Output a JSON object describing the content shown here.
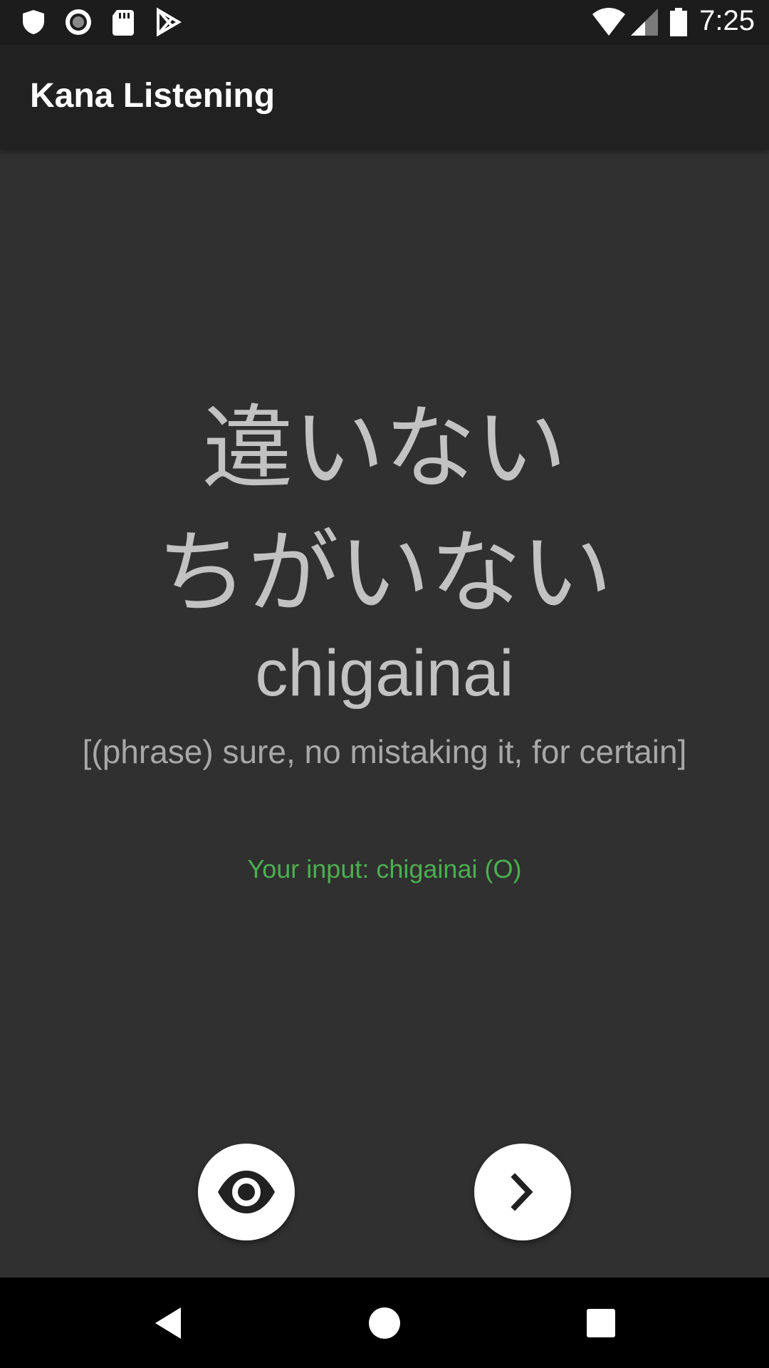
{
  "status_bar": {
    "time": "7:25",
    "icons_left": [
      "shield-icon",
      "record-icon",
      "sd-card-icon",
      "play-store-icon"
    ],
    "icons_right": [
      "wifi-icon",
      "cellular-signal-icon",
      "battery-icon"
    ]
  },
  "app_bar": {
    "title": "Kana Listening"
  },
  "card": {
    "kanji": "違いない",
    "kana": "ちがいない",
    "romaji": "chigainai",
    "meaning": "[(phrase) sure, no mistaking it, for certain]",
    "user_input": "Your input: chigainai (O)"
  },
  "actions": {
    "reveal_icon": "eye-icon",
    "next_icon": "chevron-right-icon"
  },
  "nav_bar": {
    "back_icon": "back-triangle-icon",
    "home_icon": "home-circle-icon",
    "recents_icon": "recents-square-icon"
  },
  "colors": {
    "background": "#303030",
    "app_bar": "#212121",
    "status_bar": "#1c1c1c",
    "text_primary": "#c2c2c2",
    "text_secondary": "#a8a8a8",
    "correct_green": "#4caf50",
    "fab": "#ffffff"
  }
}
